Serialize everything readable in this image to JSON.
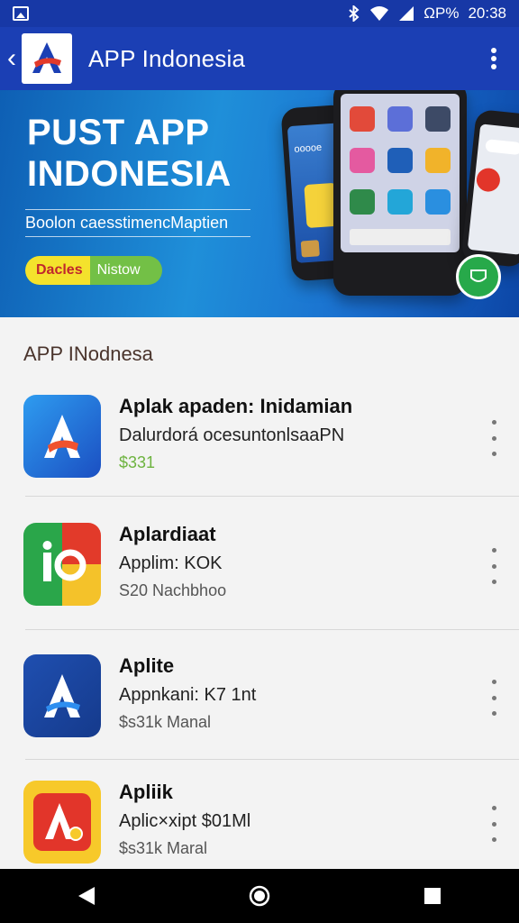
{
  "status_bar": {
    "icons": [
      "image-icon",
      "bluetooth-icon",
      "wifi-icon",
      "signal-icon"
    ],
    "battery": "ΩP%",
    "time": "20:38"
  },
  "toolbar": {
    "title": "APP Indonesia",
    "back_icon": "back-arrow-icon",
    "menu_icon": "overflow-menu-icon"
  },
  "banner": {
    "title_line1": "PUST APP",
    "title_line2": "INDONESIA",
    "subtitle": "Boolon caesstimencMaptien",
    "pill_left": "Dacles",
    "pill_right": "Nistow"
  },
  "section": {
    "title": "APP INodnesa"
  },
  "apps": [
    {
      "name": "Aplak apaden: Inidamian",
      "desc": "Dalurdorá ocesuntonlsaaPN",
      "price": "$331",
      "price_color": "#6db33f"
    },
    {
      "name": "Aplardiaat",
      "desc": "Applim: KOK",
      "price": "S20 Nachbhoo",
      "price_color": "#555555"
    },
    {
      "name": "Aplite",
      "desc": "Appnkani: K7 1nt",
      "price": "$s31k Manal",
      "price_color": "#555555"
    },
    {
      "name": "Apliik",
      "desc": "Aplic×xipt $01Ml",
      "price": "$s31k Maral",
      "price_color": "#555555"
    }
  ],
  "navbar": {
    "back": "triangle-back-icon",
    "home": "circle-home-icon",
    "recents": "square-recents-icon"
  },
  "colors": {
    "primary": "#1b3fb4",
    "status_bar": "#1738a6",
    "price_green": "#6db33f"
  }
}
